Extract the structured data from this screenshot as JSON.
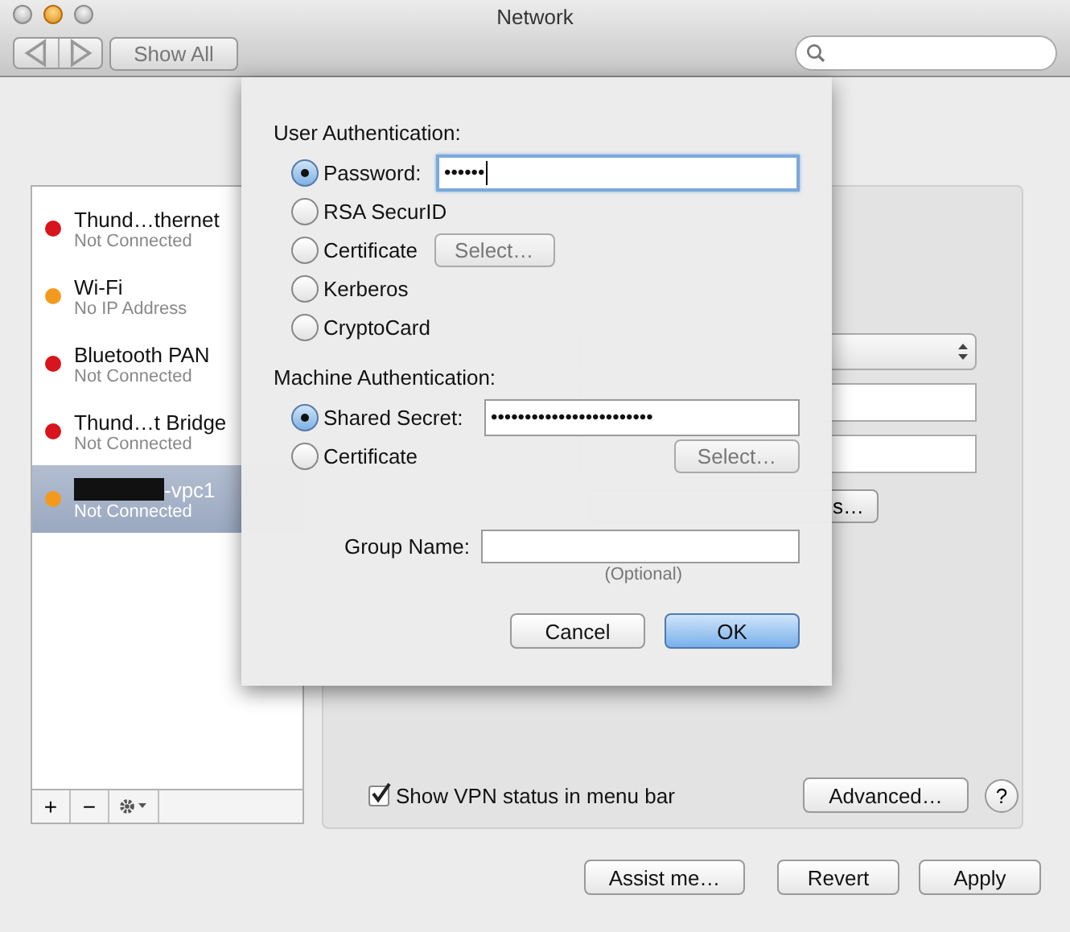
{
  "window": {
    "title": "Network"
  },
  "toolbar": {
    "show_all": "Show All"
  },
  "services": [
    {
      "name": "Thund…thernet",
      "status": "Not Connected",
      "color": "#d8141c",
      "selected": false,
      "redacted": false
    },
    {
      "name": "Wi-Fi",
      "status": "No IP Address",
      "color": "#f39a1e",
      "selected": false,
      "redacted": false
    },
    {
      "name": "Bluetooth PAN",
      "status": "Not Connected",
      "color": "#d8141c",
      "selected": false,
      "redacted": false
    },
    {
      "name": "Thund…t Bridge",
      "status": "Not Connected",
      "color": "#d8141c",
      "selected": false,
      "redacted": false
    },
    {
      "name": "-vpc1",
      "status": "Not Connected",
      "color": "#f39a1e",
      "selected": true,
      "redacted": true
    }
  ],
  "list_buttons": [
    "+",
    "−"
  ],
  "detail": {
    "auth_button_tail": "s…",
    "show_vpn_status": {
      "label": "Show VPN status in menu bar",
      "checked": true
    },
    "advanced": "Advanced…",
    "help": "?"
  },
  "footer_buttons": [
    "Assist me…",
    "Revert",
    "Apply"
  ],
  "sheet": {
    "user_auth_title": "User Authentication:",
    "user_options": [
      {
        "label": "Password:",
        "selected": true,
        "kind": "field",
        "value": "••••••",
        "focused": true
      },
      {
        "label": "RSA SecurID",
        "selected": false,
        "kind": "plain"
      },
      {
        "label": "Certificate",
        "selected": false,
        "kind": "button",
        "button": "Select…"
      },
      {
        "label": "Kerberos",
        "selected": false,
        "kind": "plain"
      },
      {
        "label": "CryptoCard",
        "selected": false,
        "kind": "plain"
      }
    ],
    "machine_auth_title": "Machine Authentication:",
    "machine_options": [
      {
        "label": "Shared Secret:",
        "selected": true,
        "kind": "field",
        "value": "••••••••••••••••••••••••",
        "focused": false
      },
      {
        "label": "Certificate",
        "selected": false,
        "kind": "button-right",
        "button": "Select…"
      }
    ],
    "group_name": {
      "label": "Group Name:",
      "hint": "(Optional)"
    },
    "buttons": [
      {
        "label": "Cancel",
        "default": false
      },
      {
        "label": "OK",
        "default": true
      }
    ]
  }
}
